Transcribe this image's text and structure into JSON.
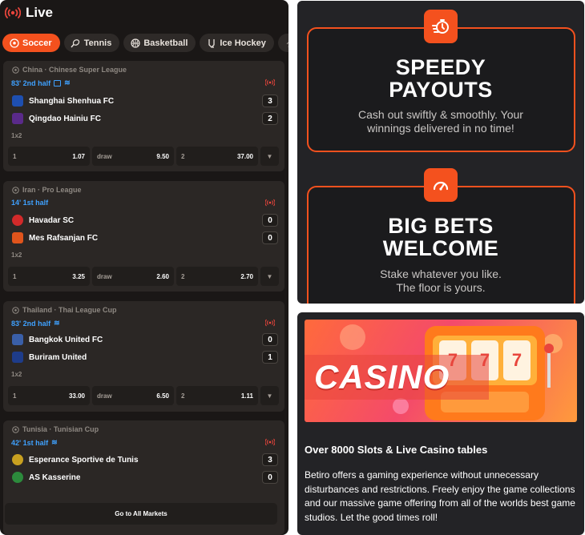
{
  "live": {
    "title": "Live",
    "icon": "live-broadcast-icon"
  },
  "tabs": [
    {
      "label": "Soccer",
      "icon": "soccer-ball-icon",
      "active": true
    },
    {
      "label": "Tennis",
      "icon": "tennis-icon",
      "active": false
    },
    {
      "label": "Basketball",
      "icon": "basketball-icon",
      "active": false
    },
    {
      "label": "Ice Hockey",
      "icon": "ice-hockey-icon",
      "active": false
    }
  ],
  "matches": [
    {
      "league": "China · Chinese Super League",
      "time": "83' 2nd half",
      "home": {
        "name": "Shanghai Shenhua FC",
        "score": "3",
        "color": "#1e4fb0"
      },
      "away": {
        "name": "Qingdao Hainiu FC",
        "score": "2",
        "color": "#5a2a8a"
      },
      "market": "1x2",
      "odds": [
        {
          "label": "1",
          "value": "1.07"
        },
        {
          "label": "draw",
          "value": "9.50"
        },
        {
          "label": "2",
          "value": "37.00"
        }
      ]
    },
    {
      "league": "Iran · Pro League",
      "time": "14' 1st half",
      "home": {
        "name": "Havadar SC",
        "score": "0",
        "color": "#d22a2a"
      },
      "away": {
        "name": "Mes Rafsanjan FC",
        "score": "0",
        "color": "#e0541c"
      },
      "market": "1x2",
      "odds": [
        {
          "label": "1",
          "value": "3.25"
        },
        {
          "label": "draw",
          "value": "2.60"
        },
        {
          "label": "2",
          "value": "2.70"
        }
      ]
    },
    {
      "league": "Thailand · Thai League Cup",
      "time": "83' 2nd half",
      "home": {
        "name": "Bangkok United FC",
        "score": "0",
        "color": "#3a5fa8"
      },
      "away": {
        "name": "Buriram United",
        "score": "1",
        "color": "#1e3c8a"
      },
      "market": "1x2",
      "odds": [
        {
          "label": "1",
          "value": "33.00"
        },
        {
          "label": "draw",
          "value": "6.50"
        },
        {
          "label": "2",
          "value": "1.11"
        }
      ]
    },
    {
      "league": "Tunisia · Tunisian Cup",
      "time": "42' 1st half",
      "home": {
        "name": "Esperance Sportive de Tunis",
        "score": "3",
        "color": "#c8a020"
      },
      "away": {
        "name": "AS Kasserine",
        "score": "0",
        "color": "#2c8a3c"
      }
    }
  ],
  "go_all_markets": "Go to All Markets",
  "promos": [
    {
      "title_line1": "SPEEDY",
      "title_line2": "PAYOUTS",
      "desc_line1": "Cash out swiftly & smoothly. Your",
      "desc_line2": "winnings delivered in no time!",
      "icon": "stopwatch-icon"
    },
    {
      "title_line1": "BIG BETS",
      "title_line2": "WELCOME",
      "desc_line1": "Stake whatever you like.",
      "desc_line2": "The floor is yours.",
      "icon": "speedometer-icon"
    }
  ],
  "casino": {
    "banner_word": "CASINO",
    "heading": "Over 8000 Slots & Live Casino tables",
    "body": "Betiro offers a gaming experience without unnecessary disturbances and restrictions. Freely enjoy the game collections and our massive game offering from all of the worlds best game studios. Let the good times roll!"
  },
  "colors": {
    "accent": "#f4511e",
    "live_time": "#3fa1ff",
    "live_icon": "#e8453c"
  }
}
